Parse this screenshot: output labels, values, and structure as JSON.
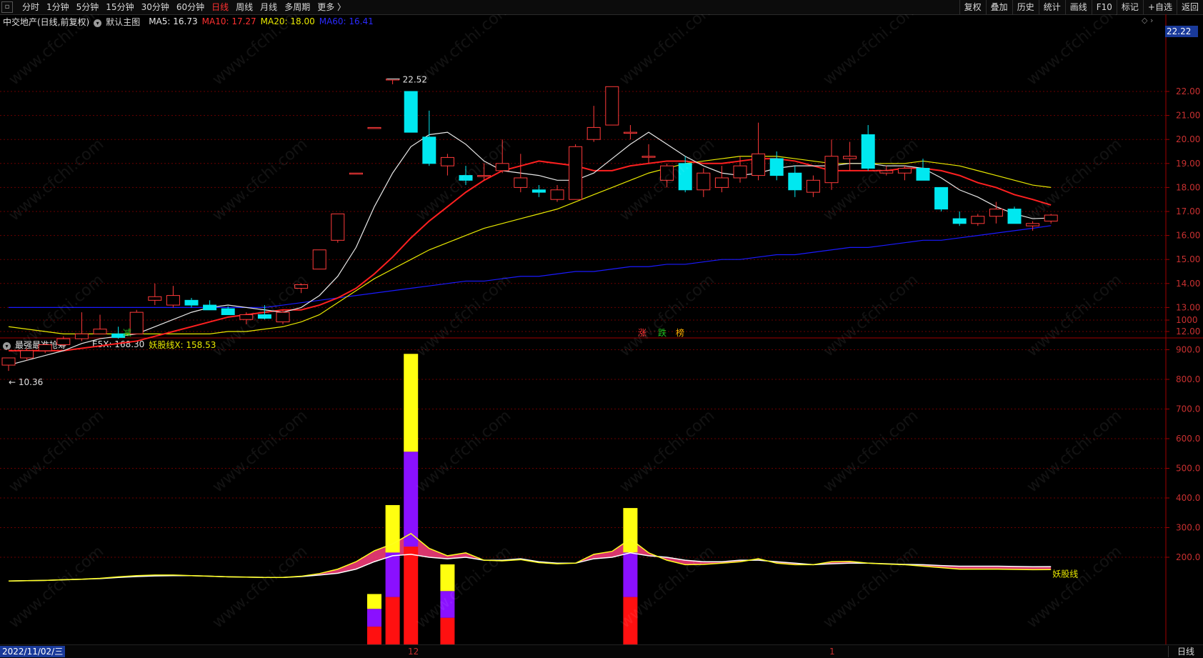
{
  "toolbar": {
    "left": [
      "分时",
      "1分钟",
      "5分钟",
      "15分钟",
      "30分钟",
      "60分钟",
      "日线",
      "周线",
      "月线",
      "多周期",
      "更多 〉"
    ],
    "active": "日线",
    "right": [
      "复权",
      "叠加",
      "历史",
      "统计",
      "画线",
      "F10",
      "标记",
      "+自选",
      "返回"
    ]
  },
  "main_info": {
    "name": "中交地产(日线,前复权)",
    "template": "默认主图",
    "ma5": "MA5: 16.73",
    "ma10": "MA10: 17.27",
    "ma20": "MA20: 18.00",
    "ma60": "MA60: 16.41"
  },
  "sub_info": {
    "name": "最强最准抢筹",
    "e5x": "E5X: 168.30",
    "yao": "妖股线X: 158.53"
  },
  "current_price": "22.22",
  "bottom": {
    "date": "2022/11/02/三",
    "month12": "12",
    "month1": "1",
    "period": "日线"
  },
  "colors": {
    "up": "#ff3a3a",
    "down": "#00e8f0",
    "ma5": "#e8e8e8",
    "ma10": "#ff2020",
    "ma20": "#e8e800",
    "ma60": "#1a1aff",
    "grid": "#6a0000"
  },
  "chart_data": {
    "type": "candlestick",
    "y_ticks": [
      "22.00",
      "21.00",
      "20.00",
      "19.00",
      "18.00",
      "17.00",
      "16.00",
      "15.00",
      "14.00",
      "13.00",
      "12.00"
    ],
    "sub_ticks": [
      "1000",
      "900.0",
      "800.0",
      "700.0",
      "600.0",
      "500.0",
      "400.0",
      "300.0",
      "200.0"
    ],
    "high_label": "22.52",
    "low_label": "10.36",
    "markers": [
      "减",
      "涨",
      "跌",
      "榜"
    ],
    "candles": [
      {
        "o": 10.6,
        "h": 10.9,
        "l": 10.36,
        "c": 10.9
      },
      {
        "o": 10.9,
        "h": 11.3,
        "l": 10.8,
        "c": 11.2
      },
      {
        "o": 11.2,
        "h": 11.5,
        "l": 11.1,
        "c": 11.45
      },
      {
        "o": 11.45,
        "h": 11.8,
        "l": 11.4,
        "c": 11.7
      },
      {
        "o": 11.7,
        "h": 12.8,
        "l": 11.6,
        "c": 11.9
      },
      {
        "o": 11.9,
        "h": 12.7,
        "l": 11.9,
        "c": 12.1
      },
      {
        "o": 11.9,
        "h": 12.2,
        "l": 11.7,
        "c": 11.75
      },
      {
        "o": 11.9,
        "h": 12.9,
        "l": 11.9,
        "c": 12.8
      },
      {
        "o": 13.3,
        "h": 14.0,
        "l": 13.1,
        "c": 13.45
      },
      {
        "o": 13.1,
        "h": 13.9,
        "l": 13.0,
        "c": 13.5
      },
      {
        "o": 13.3,
        "h": 13.4,
        "l": 13.0,
        "c": 13.1
      },
      {
        "o": 13.1,
        "h": 13.3,
        "l": 12.9,
        "c": 12.9
      },
      {
        "o": 12.95,
        "h": 13.05,
        "l": 12.7,
        "c": 12.7
      },
      {
        "o": 12.5,
        "h": 12.8,
        "l": 12.3,
        "c": 12.7
      },
      {
        "o": 12.7,
        "h": 13.1,
        "l": 12.5,
        "c": 12.55
      },
      {
        "o": 12.4,
        "h": 12.9,
        "l": 12.3,
        "c": 12.8
      },
      {
        "o": 13.8,
        "h": 14.0,
        "l": 13.6,
        "c": 13.95
      },
      {
        "o": 14.6,
        "h": 15.4,
        "l": 14.6,
        "c": 15.4
      },
      {
        "o": 15.8,
        "h": 16.9,
        "l": 15.7,
        "c": 16.9
      },
      {
        "o": 18.6,
        "h": 18.6,
        "l": 18.6,
        "c": 18.6
      },
      {
        "o": 20.5,
        "h": 20.5,
        "l": 20.5,
        "c": 20.5
      },
      {
        "o": 22.52,
        "h": 22.52,
        "l": 22.3,
        "c": 22.52
      },
      {
        "o": 22.0,
        "h": 22.0,
        "l": 20.3,
        "c": 20.3
      },
      {
        "o": 20.1,
        "h": 21.2,
        "l": 18.9,
        "c": 19.0
      },
      {
        "o": 18.9,
        "h": 19.4,
        "l": 18.5,
        "c": 19.25
      },
      {
        "o": 18.5,
        "h": 18.9,
        "l": 18.1,
        "c": 18.3
      },
      {
        "o": 18.5,
        "h": 19.0,
        "l": 18.3,
        "c": 18.5
      },
      {
        "o": 18.7,
        "h": 20.0,
        "l": 18.6,
        "c": 19.0
      },
      {
        "o": 18.0,
        "h": 19.4,
        "l": 17.8,
        "c": 18.4
      },
      {
        "o": 17.9,
        "h": 18.1,
        "l": 17.6,
        "c": 17.8
      },
      {
        "o": 17.5,
        "h": 18.1,
        "l": 17.4,
        "c": 17.9
      },
      {
        "o": 17.5,
        "h": 19.8,
        "l": 17.5,
        "c": 19.7
      },
      {
        "o": 20.0,
        "h": 21.4,
        "l": 19.9,
        "c": 20.5
      },
      {
        "o": 20.6,
        "h": 22.2,
        "l": 20.6,
        "c": 22.2
      },
      {
        "o": 20.3,
        "h": 20.6,
        "l": 20.0,
        "c": 20.3
      },
      {
        "o": 19.3,
        "h": 19.8,
        "l": 19.0,
        "c": 19.3
      },
      {
        "o": 18.3,
        "h": 19.0,
        "l": 18.0,
        "c": 18.9
      },
      {
        "o": 19.0,
        "h": 19.3,
        "l": 17.8,
        "c": 17.9
      },
      {
        "o": 17.9,
        "h": 18.8,
        "l": 17.6,
        "c": 18.6
      },
      {
        "o": 18.0,
        "h": 18.9,
        "l": 17.8,
        "c": 18.4
      },
      {
        "o": 18.4,
        "h": 19.3,
        "l": 18.2,
        "c": 18.9
      },
      {
        "o": 18.5,
        "h": 20.7,
        "l": 18.3,
        "c": 19.4
      },
      {
        "o": 19.2,
        "h": 19.5,
        "l": 18.3,
        "c": 18.5
      },
      {
        "o": 18.6,
        "h": 18.9,
        "l": 17.6,
        "c": 17.9
      },
      {
        "o": 17.8,
        "h": 18.5,
        "l": 17.6,
        "c": 18.3
      },
      {
        "o": 18.2,
        "h": 20.0,
        "l": 17.9,
        "c": 19.3
      },
      {
        "o": 19.2,
        "h": 19.9,
        "l": 18.7,
        "c": 19.3
      },
      {
        "o": 20.2,
        "h": 20.6,
        "l": 18.7,
        "c": 18.8
      },
      {
        "o": 18.6,
        "h": 18.9,
        "l": 18.5,
        "c": 18.7
      },
      {
        "o": 18.6,
        "h": 18.9,
        "l": 18.3,
        "c": 18.8
      },
      {
        "o": 18.8,
        "h": 19.2,
        "l": 18.3,
        "c": 18.3
      },
      {
        "o": 18.0,
        "h": 18.0,
        "l": 17.0,
        "c": 17.1
      },
      {
        "o": 16.7,
        "h": 17.0,
        "l": 16.4,
        "c": 16.5
      },
      {
        "o": 16.5,
        "h": 16.9,
        "l": 16.4,
        "c": 16.8
      },
      {
        "o": 16.8,
        "h": 17.4,
        "l": 16.5,
        "c": 17.1
      },
      {
        "o": 17.1,
        "h": 17.2,
        "l": 16.5,
        "c": 16.5
      },
      {
        "o": 16.4,
        "h": 16.6,
        "l": 16.2,
        "c": 16.5
      },
      {
        "o": 16.6,
        "h": 16.9,
        "l": 16.5,
        "c": 16.85
      }
    ],
    "ma5": [
      10.6,
      10.8,
      11.0,
      11.2,
      11.5,
      11.7,
      11.8,
      11.9,
      12.2,
      12.5,
      12.8,
      13.0,
      13.1,
      13.0,
      12.9,
      12.8,
      13.0,
      13.5,
      14.3,
      15.5,
      17.2,
      18.6,
      19.7,
      20.2,
      20.3,
      19.8,
      19.1,
      18.7,
      18.6,
      18.5,
      18.3,
      18.3,
      18.6,
      19.2,
      19.8,
      20.3,
      19.8,
      19.3,
      18.9,
      18.6,
      18.5,
      18.6,
      18.8,
      18.9,
      18.9,
      18.9,
      19.0,
      19.0,
      18.9,
      18.9,
      18.8,
      18.4,
      17.9,
      17.6,
      17.2,
      16.9,
      16.7,
      16.73
    ],
    "ma10": [
      11.2,
      11.2,
      11.2,
      11.2,
      11.3,
      11.4,
      11.5,
      11.6,
      11.8,
      12.0,
      12.2,
      12.4,
      12.6,
      12.7,
      12.8,
      12.9,
      12.9,
      13.1,
      13.4,
      13.8,
      14.4,
      15.1,
      15.9,
      16.6,
      17.2,
      17.8,
      18.3,
      18.7,
      18.9,
      19.1,
      19.0,
      18.9,
      18.7,
      18.7,
      18.9,
      19.0,
      19.1,
      19.1,
      19.0,
      19.0,
      19.1,
      19.2,
      19.2,
      19.1,
      18.9,
      18.7,
      18.7,
      18.7,
      18.7,
      18.8,
      18.8,
      18.7,
      18.5,
      18.2,
      18.0,
      17.7,
      17.5,
      17.27
    ],
    "ma20": [
      12.2,
      12.1,
      12.0,
      11.9,
      11.9,
      11.9,
      11.9,
      11.9,
      11.9,
      11.9,
      11.9,
      11.9,
      12.0,
      12.0,
      12.1,
      12.2,
      12.4,
      12.7,
      13.2,
      13.7,
      14.2,
      14.6,
      15.0,
      15.4,
      15.7,
      16.0,
      16.3,
      16.5,
      16.7,
      16.9,
      17.1,
      17.4,
      17.7,
      18.0,
      18.3,
      18.6,
      18.8,
      19.0,
      19.1,
      19.2,
      19.3,
      19.3,
      19.3,
      19.2,
      19.1,
      19.0,
      19.0,
      19.0,
      19.0,
      19.0,
      19.1,
      19.0,
      18.9,
      18.7,
      18.5,
      18.3,
      18.1,
      18.0
    ],
    "ma60": [
      13.0,
      13.0,
      13.0,
      13.0,
      13.0,
      13.0,
      13.0,
      13.0,
      13.0,
      13.0,
      13.0,
      13.0,
      13.0,
      13.0,
      13.0,
      13.1,
      13.2,
      13.3,
      13.4,
      13.5,
      13.6,
      13.7,
      13.8,
      13.9,
      14.0,
      14.1,
      14.1,
      14.2,
      14.3,
      14.3,
      14.4,
      14.5,
      14.5,
      14.6,
      14.7,
      14.7,
      14.8,
      14.8,
      14.9,
      15.0,
      15.0,
      15.1,
      15.2,
      15.2,
      15.3,
      15.4,
      15.5,
      15.5,
      15.6,
      15.7,
      15.8,
      15.8,
      15.9,
      16.0,
      16.1,
      16.2,
      16.3,
      16.41
    ],
    "sub": {
      "e5x": [
        120,
        121,
        122,
        124,
        126,
        128,
        132,
        135,
        137,
        138,
        138,
        136,
        134,
        133,
        132,
        132,
        135,
        140,
        146,
        160,
        185,
        205,
        210,
        200,
        195,
        200,
        190,
        190,
        195,
        185,
        180,
        180,
        195,
        200,
        215,
        205,
        200,
        190,
        185,
        185,
        190,
        190,
        185,
        180,
        175,
        178,
        180,
        180,
        178,
        176,
        175,
        172,
        170,
        170,
        170,
        169,
        168,
        168.3
      ],
      "yao": [
        120,
        121,
        122,
        124,
        126,
        129,
        134,
        138,
        140,
        140,
        138,
        136,
        134,
        133,
        132,
        132,
        136,
        145,
        160,
        185,
        222,
        245,
        280,
        230,
        205,
        215,
        190,
        188,
        192,
        182,
        178,
        180,
        210,
        220,
        262,
        215,
        190,
        175,
        176,
        180,
        185,
        195,
        180,
        175,
        175,
        185,
        186,
        180,
        177,
        175,
        170,
        165,
        160,
        160,
        160,
        159,
        158,
        158.53
      ],
      "bars": [
        {
          "i": 19,
          "red": 0,
          "purple": 0,
          "yellow": 0
        },
        {
          "i": 20,
          "red": 60,
          "purple": 60,
          "yellow": 50
        },
        {
          "i": 21,
          "red": 160,
          "purple": 150,
          "yellow": 160
        },
        {
          "i": 22,
          "red": 330,
          "purple": 320,
          "yellow": 330
        },
        {
          "i": 24,
          "red": 90,
          "purple": 90,
          "yellow": 90
        },
        {
          "i": 34,
          "red": 160,
          "purple": 150,
          "yellow": 150
        }
      ]
    }
  }
}
